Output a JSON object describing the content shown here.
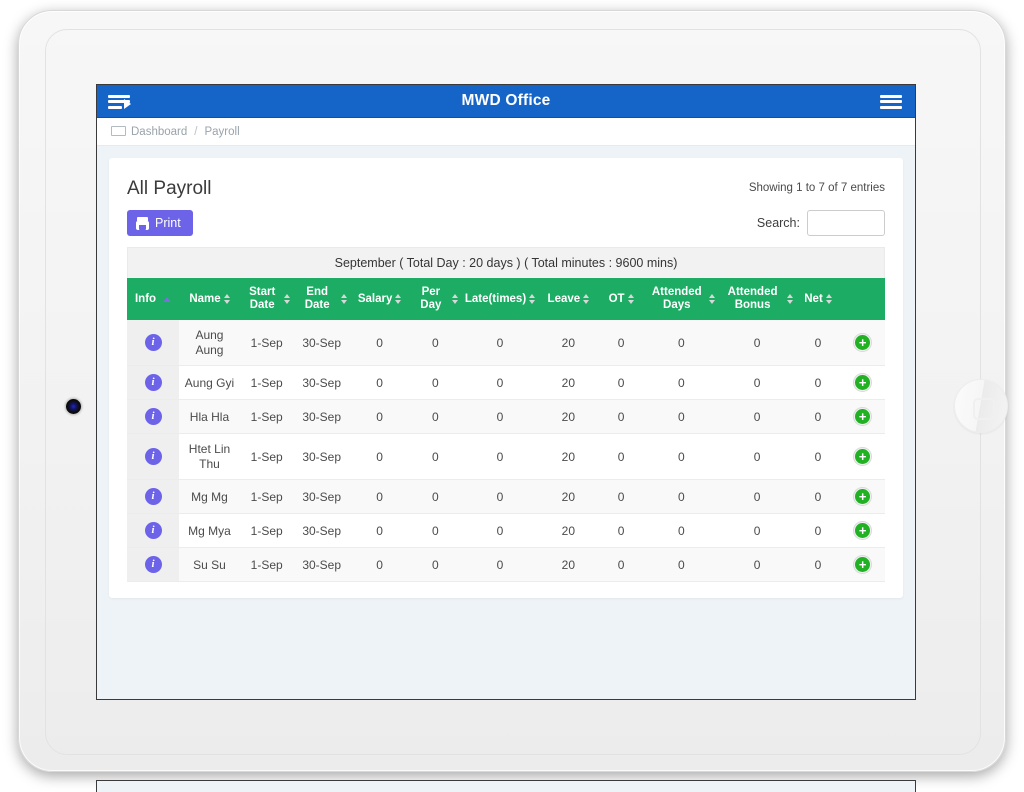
{
  "app": {
    "navbar": {
      "title": "MWD Office",
      "sidebar_toggle_icon": "menu-arrow-icon",
      "menu_toggle_icon": "hamburger-icon"
    },
    "breadcrumb": {
      "home_icon": "monitor-icon",
      "items": [
        "Dashboard",
        "Payroll"
      ],
      "separator": "/"
    }
  },
  "card": {
    "title": "All Payroll",
    "entries_info": "Showing 1 to 7 of 7 entries",
    "print_label": "Print",
    "print_icon": "printer-icon",
    "search_label": "Search:",
    "search_value": "",
    "search_placeholder": ""
  },
  "table": {
    "summary_banner": "September ( Total Day : 20 days ) ( Total minutes : 9600 mins)",
    "columns": [
      {
        "label": "Info",
        "sort": "asc"
      },
      {
        "label": "Name",
        "sort": "none"
      },
      {
        "label": "Start Date",
        "sort": "none"
      },
      {
        "label": "End Date",
        "sort": "none"
      },
      {
        "label": "Salary",
        "sort": "none"
      },
      {
        "label": "Per Day",
        "sort": "none"
      },
      {
        "label": "Late(times)",
        "sort": "none"
      },
      {
        "label": "Leave",
        "sort": "none"
      },
      {
        "label": "OT",
        "sort": "none"
      },
      {
        "label": "Attended Days",
        "sort": "none"
      },
      {
        "label": "Attended Bonus",
        "sort": "none"
      },
      {
        "label": "Net",
        "sort": "none"
      },
      {
        "label": "",
        "sort": "none"
      }
    ],
    "rows": [
      {
        "info": "i",
        "name": "Aung Aung",
        "start": "1-Sep",
        "end": "30-Sep",
        "salary": "0",
        "per_day": "0",
        "late": "0",
        "leave": "20",
        "ot": "0",
        "attended_days": "0",
        "attended_bonus": "0",
        "net": "0",
        "add": "+"
      },
      {
        "info": "i",
        "name": "Aung Gyi",
        "start": "1-Sep",
        "end": "30-Sep",
        "salary": "0",
        "per_day": "0",
        "late": "0",
        "leave": "20",
        "ot": "0",
        "attended_days": "0",
        "attended_bonus": "0",
        "net": "0",
        "add": "+"
      },
      {
        "info": "i",
        "name": "Hla Hla",
        "start": "1-Sep",
        "end": "30-Sep",
        "salary": "0",
        "per_day": "0",
        "late": "0",
        "leave": "20",
        "ot": "0",
        "attended_days": "0",
        "attended_bonus": "0",
        "net": "0",
        "add": "+"
      },
      {
        "info": "i",
        "name": "Htet Lin Thu",
        "start": "1-Sep",
        "end": "30-Sep",
        "salary": "0",
        "per_day": "0",
        "late": "0",
        "leave": "20",
        "ot": "0",
        "attended_days": "0",
        "attended_bonus": "0",
        "net": "0",
        "add": "+"
      },
      {
        "info": "i",
        "name": "Mg Mg",
        "start": "1-Sep",
        "end": "30-Sep",
        "salary": "0",
        "per_day": "0",
        "late": "0",
        "leave": "20",
        "ot": "0",
        "attended_days": "0",
        "attended_bonus": "0",
        "net": "0",
        "add": "+"
      },
      {
        "info": "i",
        "name": "Mg Mya",
        "start": "1-Sep",
        "end": "30-Sep",
        "salary": "0",
        "per_day": "0",
        "late": "0",
        "leave": "20",
        "ot": "0",
        "attended_days": "0",
        "attended_bonus": "0",
        "net": "0",
        "add": "+"
      },
      {
        "info": "i",
        "name": "Su Su",
        "start": "1-Sep",
        "end": "30-Sep",
        "salary": "0",
        "per_day": "0",
        "late": "0",
        "leave": "20",
        "ot": "0",
        "attended_days": "0",
        "attended_bonus": "0",
        "net": "0",
        "add": "+"
      }
    ]
  },
  "colors": {
    "navbar_blue": "#1565c8",
    "table_header_green": "#1cac63",
    "accent_purple": "#6c63e8",
    "add_green": "#22b024",
    "page_bg": "#eef3f7"
  }
}
